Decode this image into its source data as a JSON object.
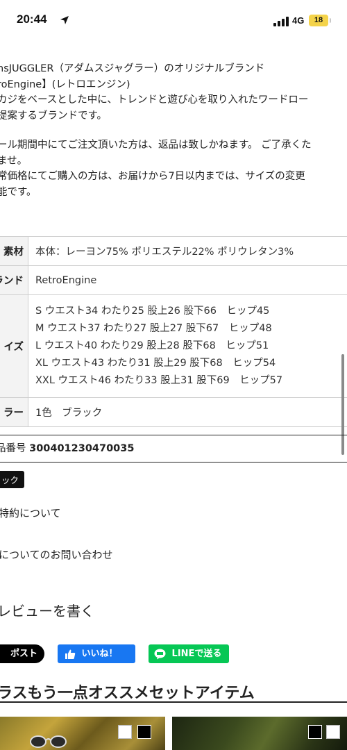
{
  "status_bar": {
    "time": "20:44",
    "network": "4G",
    "battery": "18"
  },
  "description": {
    "paragraph1": [
      "nsJUGGLER（アダムスジャグラー）のオリジナルブランド",
      "roEngine】(レトロエンジン)",
      "カジをベースとした中に、トレンドと遊び心を取り入れたワードロー",
      "提案するブランドです。"
    ],
    "paragraph2": [
      "ール期間中にてご注文頂いた方は、返品は致しかねます。 ご了承くた",
      "ませ。",
      "常価格にてご購入の方は、お届けから7日以内までは、サイズの変更",
      "能です。"
    ]
  },
  "spec_table": {
    "material": {
      "label": "素材",
      "value": "本体：レーヨン75% ポリエステル22% ポリウレタン3%"
    },
    "brand": {
      "label": "ランド",
      "value": "RetroEngine"
    },
    "size": {
      "label": "イズ",
      "lines": [
        "S ウエスト34 わたり25 股上26 股下66　ヒップ45",
        "M ウエスト37 わたり27 股上27 股下67　ヒップ48",
        "L ウエスト40 わたり29 股上28 股下68　ヒップ51",
        "XL ウエスト43 わたり31 股上29 股下68　ヒップ54",
        "XXL ウエスト46 わたり33 股上31 股下69　ヒップ57"
      ]
    },
    "color": {
      "label": "ラー",
      "value": "1色　ブラック"
    }
  },
  "product_number": {
    "label": "品番号",
    "value": "300401230470035"
  },
  "color_tag": "ック",
  "links": {
    "terms": "特約について",
    "inquiry": "についてのお問い合わせ"
  },
  "review_label": "レビューを書く",
  "share": {
    "post": "ポスト",
    "like": "いいね！",
    "line": "LINEで送る"
  },
  "recommend_title": "ラスもう一点オススメセットアイテム",
  "colors": {
    "facebook": "#1877f2",
    "line": "#06c755",
    "battery": "#f4d34a"
  }
}
